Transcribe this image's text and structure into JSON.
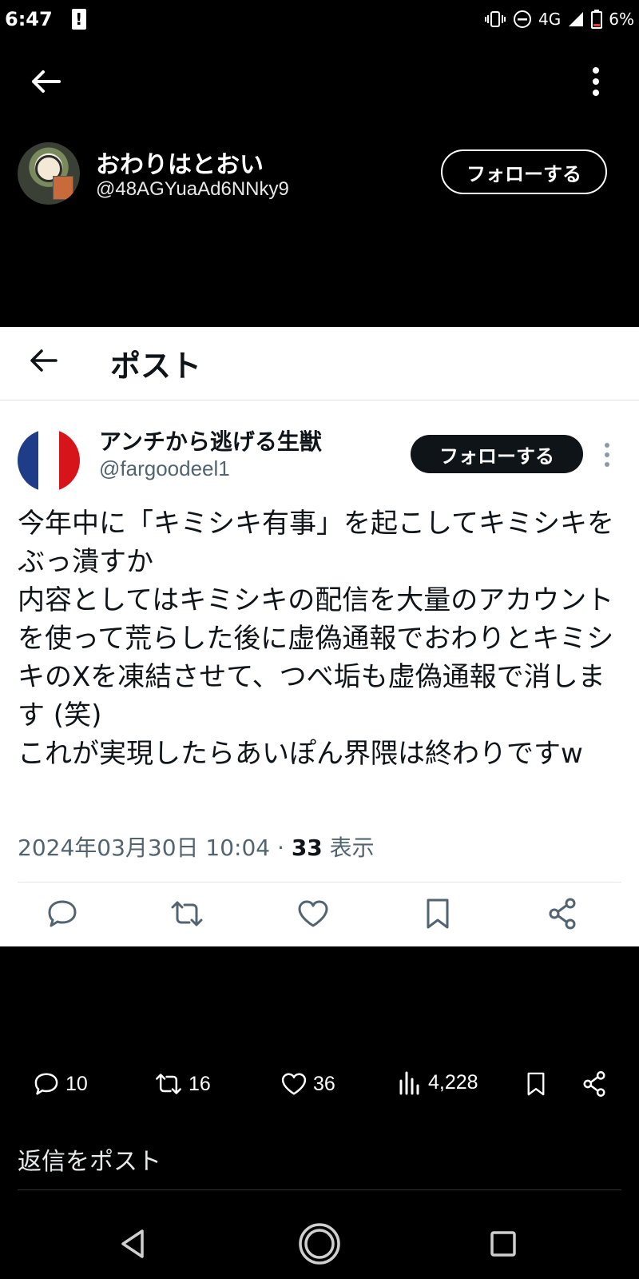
{
  "status_bar": {
    "time": "6:47",
    "alert": "!",
    "network": "4G",
    "battery": "6%"
  },
  "profile_header": {
    "name": "おわりはとおい",
    "handle": "@48AGYuaAd6NNky9",
    "follow_label": "フォローする"
  },
  "post_screen": {
    "title": "ポスト",
    "author": {
      "name": "アンチから逃げる生獣",
      "handle": "@fargoodeel1",
      "follow_label": "フォローする",
      "avatar_flag_colors": [
        "#1f3c88",
        "#ffffff",
        "#d7141a"
      ]
    },
    "text": "今年中に「キミシキ有事」を起こしてキミシキをぶっ潰すか\n内容としてはキミシキの配信を大量のアカウントを使って荒らした後に虚偽通報でおわりとキミシキのXを凍結させて、つべ垢も虚偽通報で消します (笑)\nこれが実現したらあいぽん界隈は終わりですw",
    "timestamp": "2024年03月30日 10:04 · ",
    "views_count": "33",
    "views_label": " 表示",
    "actions": [
      "reply-icon",
      "repost-icon",
      "like-icon",
      "bookmark-icon",
      "share-icon"
    ]
  },
  "bottom_stats": {
    "replies": "10",
    "reposts": "16",
    "likes": "36",
    "views": "4,228"
  },
  "reply_placeholder": "返信をポスト",
  "colors": {
    "background": "#000000",
    "card": "#ffffff",
    "text_dark": "#0f1419",
    "text_muted": "#536471",
    "accent_blue": "#1d9bf0"
  }
}
